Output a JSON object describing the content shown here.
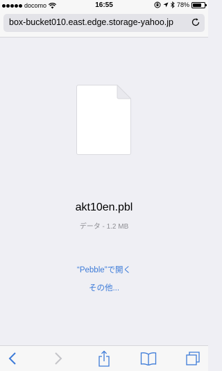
{
  "status": {
    "carrier": "docomo",
    "time": "16:55",
    "battery": "78%",
    "battery_level": 0.78,
    "icons": [
      "signal-dots-icon",
      "wifi-icon",
      "lock-rotation-icon",
      "location-icon",
      "bluetooth-icon",
      "battery-icon"
    ]
  },
  "address_bar": {
    "url": "box-bucket010.east.edge.storage-yahoo.jp",
    "reload_icon": "reload-icon"
  },
  "file": {
    "icon": "document-icon",
    "name": "akt10en.pbl",
    "info": "データ - 1.2 MB"
  },
  "actions": {
    "open_in": "“Pebble”で開く",
    "other": "その他..."
  },
  "toolbar": {
    "back_icon": "back-icon",
    "forward_icon": "forward-icon",
    "share_icon": "share-icon",
    "bookmarks_icon": "bookmarks-icon",
    "tabs_icon": "tabs-icon"
  },
  "colors": {
    "accent": "#3d7bd8",
    "background": "#efeff4",
    "bar": "#f7f7f7"
  }
}
